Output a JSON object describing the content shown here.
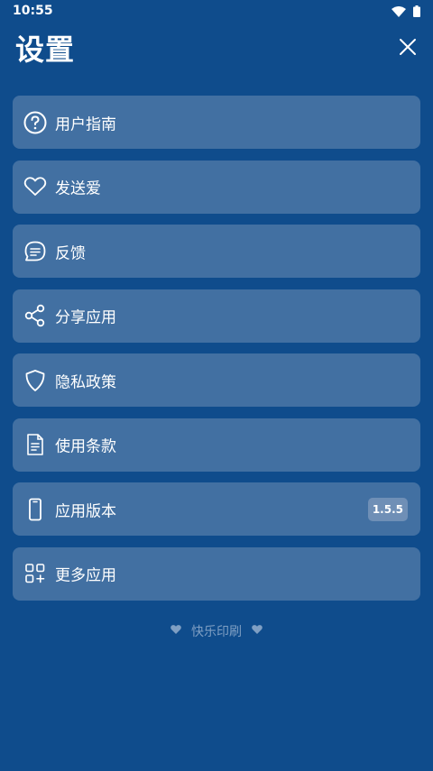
{
  "status_bar": {
    "time": "10:55",
    "icons": [
      "wifi-icon",
      "battery-icon"
    ]
  },
  "header": {
    "title": "设置",
    "close_icon": "close-icon"
  },
  "menu": {
    "items": [
      {
        "label": "用户指南",
        "icon": "help-icon"
      },
      {
        "label": "发送爱",
        "icon": "heart-icon"
      },
      {
        "label": "反馈",
        "icon": "chat-icon"
      },
      {
        "label": "分享应用",
        "icon": "share-icon"
      },
      {
        "label": "隐私政策",
        "icon": "shield-icon"
      },
      {
        "label": "使用条款",
        "icon": "document-icon"
      },
      {
        "label": "应用版本",
        "icon": "phone-icon",
        "badge": "1.5.5"
      },
      {
        "label": "更多应用",
        "icon": "apps-icon"
      }
    ]
  },
  "footer": {
    "text": "快乐印刷",
    "icon": "heart-icon"
  },
  "colors": {
    "background": "#0f4c8c",
    "card": "#4270a2",
    "badge": "#6f8fb6",
    "footer_text": "#7f9fc3"
  }
}
